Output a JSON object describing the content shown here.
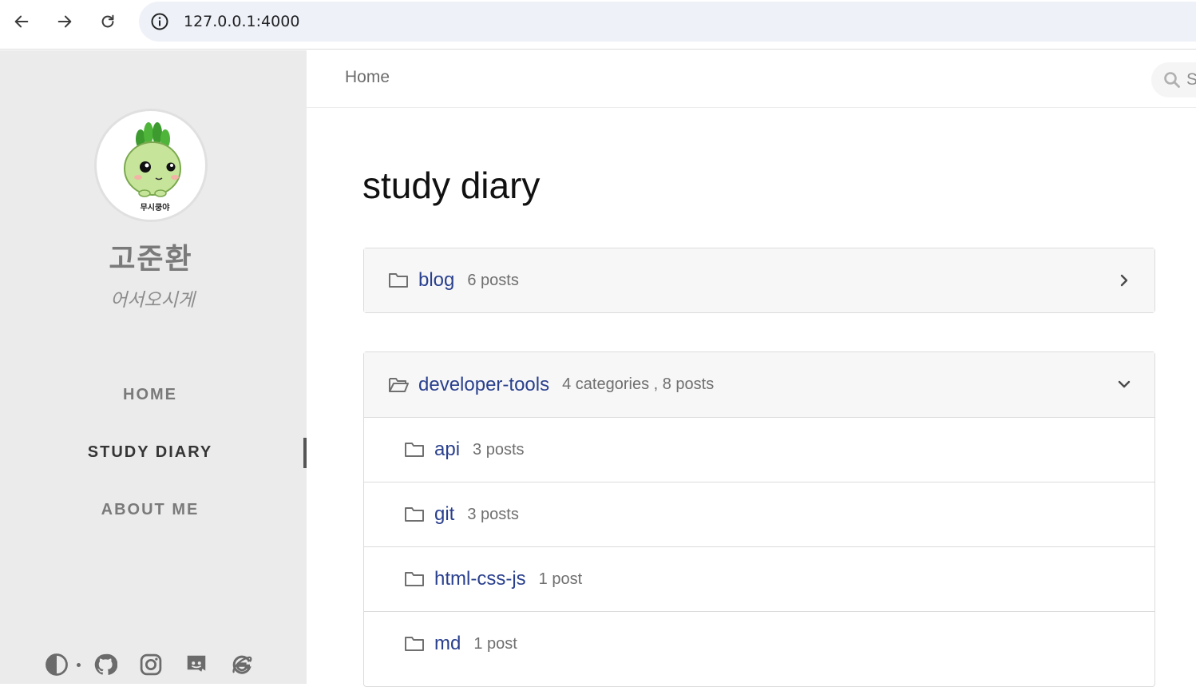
{
  "browser": {
    "url": "127.0.0.1:4000"
  },
  "sidebar": {
    "title": "고준환",
    "subtitle": "어서오시게",
    "avatar_caption": "무시쿵야",
    "nav": [
      {
        "label": "HOME"
      },
      {
        "label": "STUDY DIARY"
      },
      {
        "label": "ABOUT ME"
      }
    ],
    "footer_icons": [
      "theme-toggle-icon",
      "github-icon",
      "instagram-icon",
      "discord-icon",
      "internet-explorer-icon"
    ]
  },
  "topbar": {
    "breadcrumb": "Home",
    "search_placeholder": "S"
  },
  "main": {
    "title": "study diary",
    "categories": [
      {
        "name": "blog",
        "meta": "6 posts",
        "expanded": false
      },
      {
        "name": "developer-tools",
        "meta": "4 categories , 8 posts",
        "expanded": true,
        "subcategories": [
          {
            "name": "api",
            "meta": "3 posts"
          },
          {
            "name": "git",
            "meta": "3 posts"
          },
          {
            "name": "html-css-js",
            "meta": "1 post"
          },
          {
            "name": "md",
            "meta": "1 post"
          }
        ]
      }
    ]
  },
  "colors": {
    "sidebar_bg": "#ebebeb",
    "link": "#2a408e",
    "muted": "#6f6f6f"
  }
}
